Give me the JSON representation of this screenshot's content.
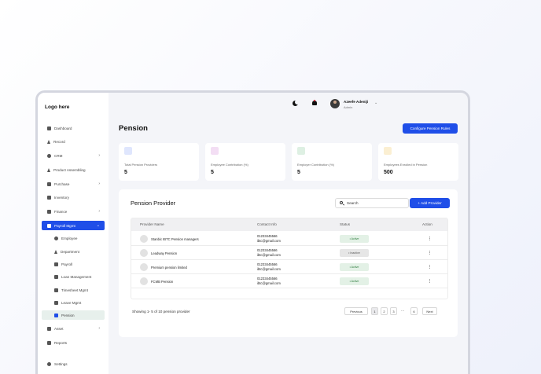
{
  "app": {
    "logo": "Logo here"
  },
  "sidebar": {
    "items": [
      {
        "label": "Dashboard",
        "icon": "grid-icon"
      },
      {
        "label": "Record",
        "icon": "record-icon"
      },
      {
        "label": "CRM",
        "icon": "people-icon"
      },
      {
        "label": "Product Assembling",
        "icon": "assembly-icon"
      },
      {
        "label": "Purchase",
        "icon": "tag-icon"
      },
      {
        "label": "Inventory",
        "icon": "box-icon"
      },
      {
        "label": "Finance",
        "icon": "finance-icon"
      },
      {
        "label": "Payroll Mgmt",
        "icon": "payroll-icon"
      }
    ],
    "sub_items": [
      {
        "label": "Employee"
      },
      {
        "label": "Department"
      },
      {
        "label": "Payroll"
      },
      {
        "label": "Loan Management"
      },
      {
        "label": "Timesheet Mgmt"
      },
      {
        "label": "Leave Mgmt"
      },
      {
        "label": "Pension"
      }
    ],
    "bottom_items": [
      {
        "label": "Asset"
      },
      {
        "label": "Reports"
      },
      {
        "label": "Settings"
      }
    ]
  },
  "header": {
    "user_name": "Azeefe Adeniji",
    "user_role": "Admin",
    "theme_icon": "moon-icon",
    "notification_icon": "bell-icon"
  },
  "page": {
    "title": "Pension",
    "configure_button": "Configure Pension Rules"
  },
  "stats": [
    {
      "label": "Total Pension Providers",
      "value": "5",
      "color": "#1f4ee8"
    },
    {
      "label": "Employee Contribution (%)",
      "value": "5",
      "color": "#8b1e8f"
    },
    {
      "label": "Employer Contribution (%)",
      "value": "5",
      "color": "#2f7a45"
    },
    {
      "label": "Employees Enrolled in Pension",
      "value": "500",
      "color": "#e0a31a"
    }
  ],
  "provider_panel": {
    "title": "Pension Provider",
    "search_placeholder": "Search",
    "add_button": "+ Add Provider",
    "columns": [
      "Provider Name",
      "Contact Info",
      "Status",
      "Action"
    ],
    "rows": [
      {
        "name": "Stanbic IBTC Pension managers",
        "phone": "01233445566",
        "email": "ibtc@gmail.com",
        "status": "• Active",
        "state": "active"
      },
      {
        "name": "Leadway Pension",
        "phone": "01233445566",
        "email": "ibtc@gmail.com",
        "status": "• Inactive",
        "state": "inactive"
      },
      {
        "name": "Premium pension limited",
        "phone": "01233445566",
        "email": "ibtc@gmail.com",
        "status": "• Active",
        "state": "active"
      },
      {
        "name": "FCMB Pension",
        "phone": "01233445566",
        "email": "ibtc@gmail.com",
        "status": "• Active",
        "state": "active"
      }
    ],
    "action_symbol": "⋮",
    "showing": "Showing 1- 5 of 10 pension provider",
    "pagination": {
      "previous": "Previous",
      "pages": [
        "1",
        "2",
        "3"
      ],
      "ellipsis": "...",
      "last": "6",
      "next": "Next"
    }
  }
}
